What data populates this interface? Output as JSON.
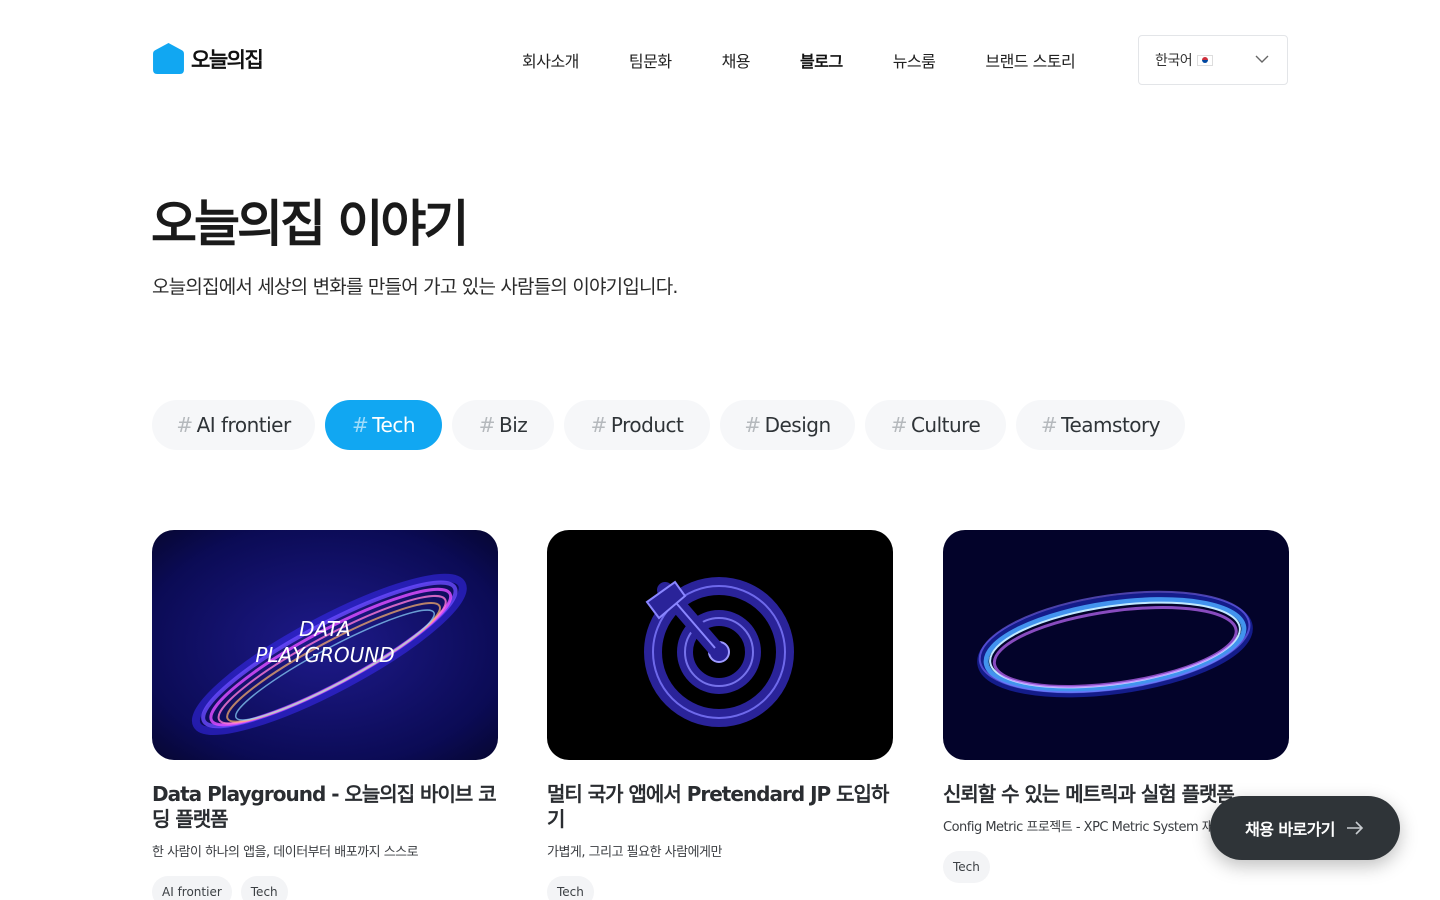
{
  "brand": {
    "name": "오늘의집",
    "color": "#35c5f0"
  },
  "nav": [
    {
      "label": "회사소개",
      "active": false
    },
    {
      "label": "팀문화",
      "active": false
    },
    {
      "label": "채용",
      "active": false
    },
    {
      "label": "블로그",
      "active": true
    },
    {
      "label": "뉴스룸",
      "active": false
    },
    {
      "label": "브랜드 스토리",
      "active": false
    }
  ],
  "language": {
    "label": "한국어",
    "icon": "korea-flag-icon"
  },
  "hero": {
    "title": "오늘의집 이야기",
    "subtitle": "오늘의집에서 세상의 변화를 만들어 가고 있는 사람들의 이야기입니다."
  },
  "tags": [
    {
      "hash": "#",
      "label": "AI frontier",
      "active": false
    },
    {
      "hash": "#",
      "label": "Tech",
      "active": true
    },
    {
      "hash": "#",
      "label": "Biz",
      "active": false
    },
    {
      "hash": "#",
      "label": "Product",
      "active": false
    },
    {
      "hash": "#",
      "label": "Design",
      "active": false
    },
    {
      "hash": "#",
      "label": "Culture",
      "active": false
    },
    {
      "hash": "#",
      "label": "Teamstory",
      "active": false
    }
  ],
  "posts": [
    {
      "image_text_1": "DATA",
      "image_text_2": "PLAYGROUND",
      "title": "Data Playground - 오늘의집 바이브 코딩 플랫폼",
      "desc": "한 사람이 하나의 앱을, 데이터부터 배포까지 스스로",
      "tags": [
        "AI frontier",
        "Tech"
      ]
    },
    {
      "title": "멀티 국가 앱에서 Pretendard JP 도입하기",
      "desc": "가볍게, 그리고 필요한 사람에게만",
      "tags": [
        "Tech"
      ]
    },
    {
      "title": "신뢰할 수 있는 메트릭과 실험 플랫폼",
      "desc": "Config Metric 프로젝트 - XPC Metric System 재구축기",
      "tags": [
        "Tech"
      ]
    }
  ],
  "cta": {
    "label": "채용 바로가기",
    "icon": "arrow-right-icon"
  },
  "colors": {
    "accent": "#11a7f2",
    "cta_bg": "#2f3438",
    "tag_bg": "#f6f7f9"
  }
}
